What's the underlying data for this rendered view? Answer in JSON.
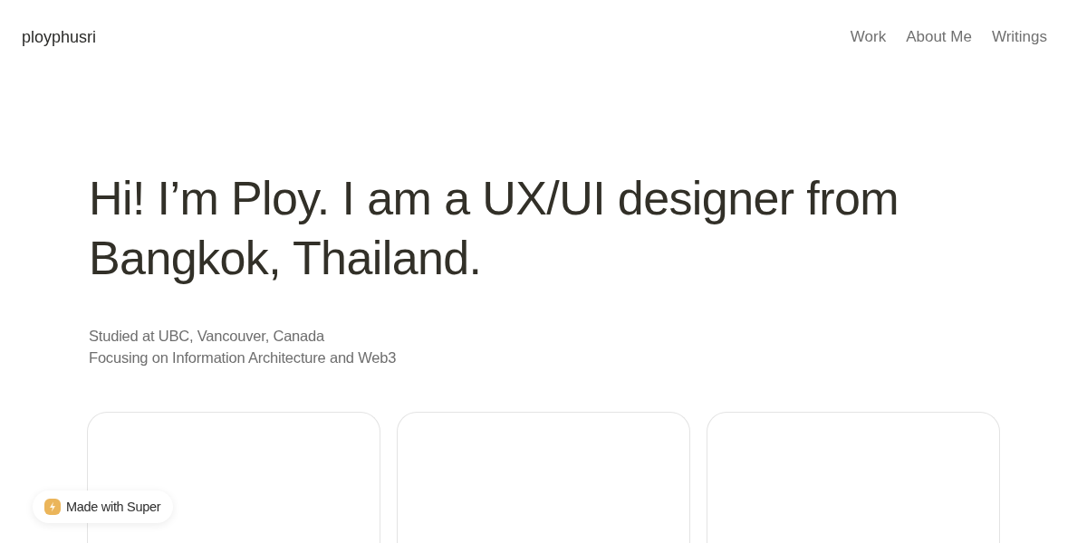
{
  "header": {
    "logo": "ployphusri",
    "nav": [
      {
        "label": "Work"
      },
      {
        "label": "About Me"
      },
      {
        "label": "Writings"
      }
    ]
  },
  "hero": {
    "heading": "Hi! I’m Ploy. I am a UX/UI designer from Bangkok, Thailand.",
    "lines": [
      "Studied at UBC, Vancouver, Canada",
      "Focusing on Information Architecture and Web3"
    ]
  },
  "project_cards": [
    {
      "kind": "blank"
    },
    {
      "kind": "blank"
    },
    {
      "kind": "blank"
    }
  ],
  "badge": {
    "label": "Made with Super"
  }
}
